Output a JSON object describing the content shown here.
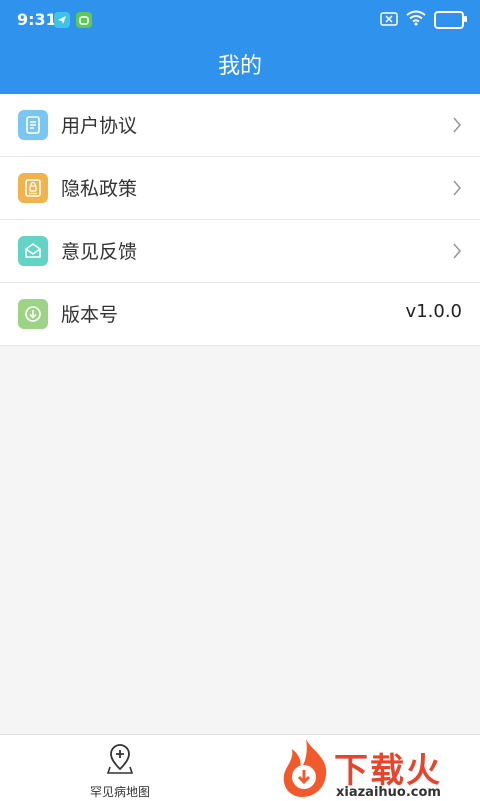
{
  "status_bar": {
    "time": "9:31",
    "battery": "100",
    "icons": [
      "location-app-icon",
      "android-app-icon",
      "no-sim-icon",
      "wifi-icon",
      "battery-icon"
    ]
  },
  "header": {
    "title": "我的"
  },
  "menu": {
    "items": [
      {
        "label": "用户协议",
        "icon": "document-icon",
        "icon_color": "#7ac6f2",
        "action": "chevron"
      },
      {
        "label": "隐私政策",
        "icon": "privacy-icon",
        "icon_color": "#f3b34c",
        "action": "chevron"
      },
      {
        "label": "意见反馈",
        "icon": "mail-icon",
        "icon_color": "#62d3c4",
        "action": "chevron"
      },
      {
        "label": "版本号",
        "icon": "download-icon",
        "icon_color": "#9dd384",
        "value": "v1.0.0"
      }
    ]
  },
  "bottom_nav": {
    "items": [
      {
        "label": "罕见病地图",
        "icon": "map-pin-plus-icon"
      }
    ]
  },
  "watermark": {
    "text_cn": "下载火",
    "text_en": "xiazaihuo.com"
  },
  "colors": {
    "primary": "#2f93ee",
    "background": "#f5f5f5",
    "divider": "#e6e6e6"
  }
}
